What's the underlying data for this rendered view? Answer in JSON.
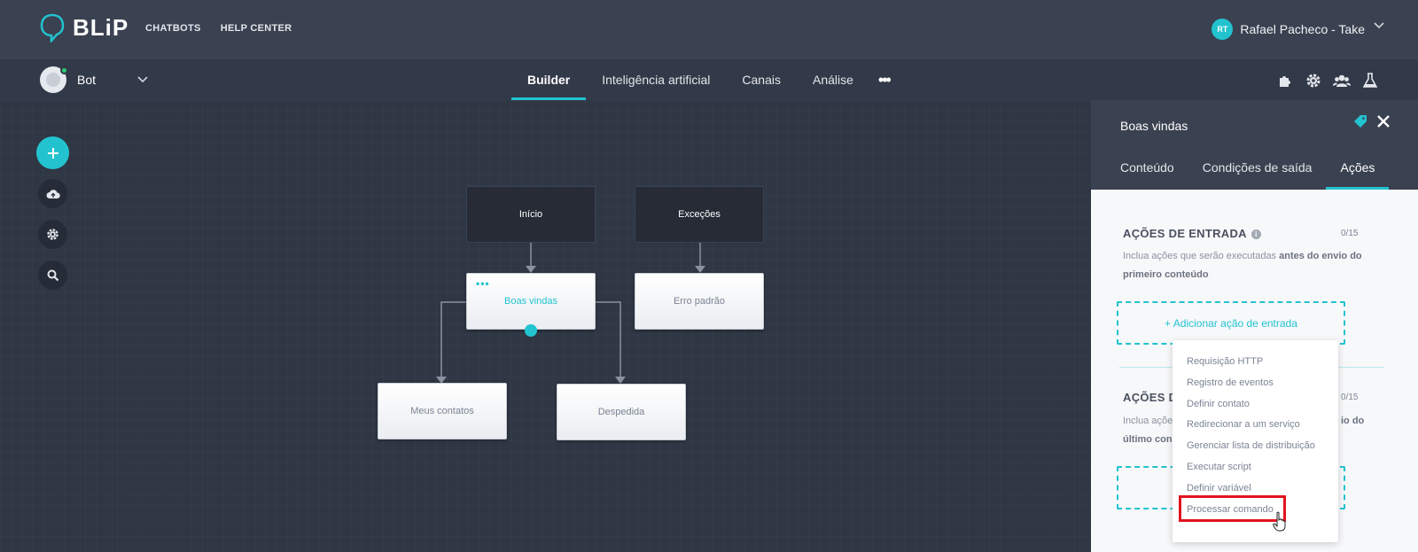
{
  "header": {
    "logo_text": "BLiP",
    "nav": [
      "CHATBOTS",
      "HELP CENTER"
    ],
    "user": {
      "initials": "RT",
      "name": "Rafael Pacheco - Take"
    }
  },
  "subbar": {
    "bot_name": "Bot",
    "tabs": [
      "Builder",
      "Inteligência artificial",
      "Canais",
      "Análise"
    ],
    "active_tab": "Builder",
    "more": "•••",
    "tools": [
      "puzzle-icon",
      "gear-icon",
      "users-icon",
      "flask-icon"
    ]
  },
  "sidebar_tools": [
    "add-icon",
    "cloud-upload-icon",
    "gear-icon",
    "search-icon"
  ],
  "flow": {
    "blocks": {
      "inicio": "Início",
      "excecoes": "Exceções",
      "boas_vindas": "Boas vindas",
      "erro_padrao": "Erro padrão",
      "meus_contatos": "Meus contatos",
      "despedida": "Despedida"
    },
    "block_dots": "•••"
  },
  "panel": {
    "title": "Boas vindas",
    "tabs": [
      "Conteúdo",
      "Condições de saída",
      "Ações"
    ],
    "active_tab": "Ações",
    "entrada": {
      "title": "AÇÕES DE ENTRADA",
      "info": "i",
      "count": "0/15",
      "desc_prefix": "Inclua ações que serão executadas ",
      "desc_bold": "antes do envio do primeiro conteúdo",
      "add_label": "+ Adicionar ação de entrada"
    },
    "saida": {
      "title": "AÇÕES D",
      "count": "0/15",
      "desc_line1_prefix": "Inclua açõe",
      "desc_line1_suffix": "io do",
      "desc_line2": "último con"
    }
  },
  "dropdown": {
    "items": [
      "Requisição HTTP",
      "Registro de eventos",
      "Definir contato",
      "Redirecionar a um serviço",
      "Gerenciar lista de distribuição",
      "Executar script",
      "Definir variável",
      "Processar comando"
    ],
    "highlighted": "Processar comando"
  },
  "colors": {
    "accent": "#22c3cf",
    "highlight": "#e1141f",
    "bg": "#2f3644"
  }
}
